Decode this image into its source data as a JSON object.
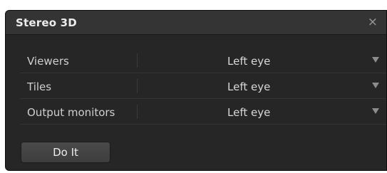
{
  "dialog": {
    "title": "Stereo 3D",
    "close_glyph": "×"
  },
  "rows": [
    {
      "label": "Viewers",
      "value": "Left eye",
      "icon": "chevron-down-icon"
    },
    {
      "label": "Tiles",
      "value": "Left eye",
      "icon": "chevron-down-icon"
    },
    {
      "label": "Output monitors",
      "value": "Left eye",
      "icon": "chevron-down-icon"
    }
  ],
  "actions": {
    "do_it_label": "Do It"
  },
  "colors": {
    "dialog_bg": "#262626",
    "titlebar_bg": "#343434",
    "text": "#cfcfcf",
    "arrow": "#8c8c8c"
  }
}
